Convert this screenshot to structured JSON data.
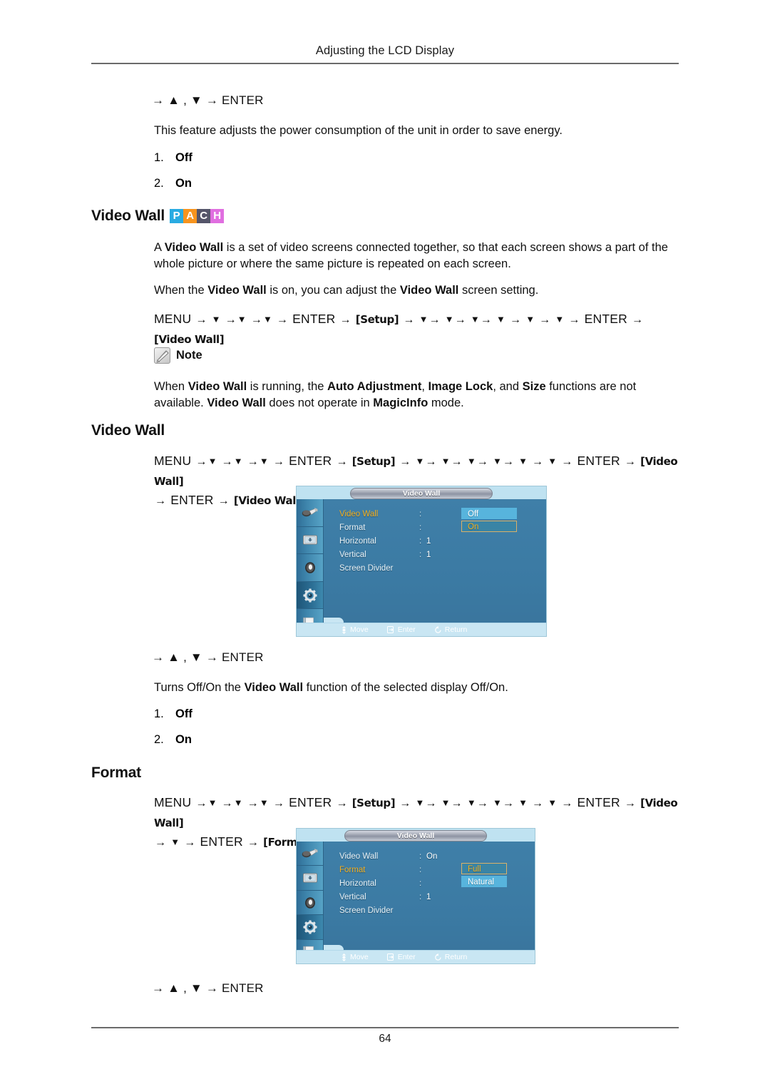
{
  "header": {
    "title": "Adjusting the LCD Display"
  },
  "footer": {
    "page_number": "64"
  },
  "top_section": {
    "key_line": "→ ▲ , ▼ → ENTER",
    "description": "This feature adjusts the power consumption of the unit in order to save energy.",
    "options": [
      {
        "num": "1.",
        "label": "Off"
      },
      {
        "num": "2.",
        "label": "On"
      }
    ]
  },
  "video_wall_section": {
    "heading": "Video Wall",
    "badges": [
      {
        "letter": "P",
        "color": "#29ABE2"
      },
      {
        "letter": "A",
        "color": "#F7941E"
      },
      {
        "letter": "C",
        "color": "#55556A"
      },
      {
        "letter": "H",
        "color": "#E06EE0"
      }
    ],
    "paragraph_1": "A Video Wall is a set of video screens connected together, so that each screen shows a part of the whole picture or where the same picture is repeated on each screen.",
    "paragraph_2": "When the Video Wall is on, you can adjust the Video Wall screen setting.",
    "nav_path": "MENU → ▼ →▼ →▼ → ENTER → [Setup] → ▼→ ▼→ ▼→ ▼ → ▼ → ▼ → ENTER → [Video Wall]",
    "nav_tokens": {
      "menu": "MENU",
      "enter": "ENTER",
      "setup": "Setup",
      "video_wall": "Video Wall"
    },
    "note_label": "Note",
    "note_text": "When Video Wall is running, the Auto Adjustment, Image Lock, and Size functions are not available. Video Wall does not operate in MagicInfo mode."
  },
  "video_wall_sub": {
    "heading": "Video Wall",
    "nav_path": "MENU →▼ →▼ →▼ → ENTER → [Setup] → ▼→ ▼→ ▼→ ▼→ ▼ → ▼ → ENTER → [Video Wall] → ENTER → [Video Wall]",
    "key_line": "→ ▲ , ▼ → ENTER",
    "description": "Turns Off/On the Video Wall function of the selected display Off/On.",
    "options": [
      {
        "num": "1.",
        "label": "Off"
      },
      {
        "num": "2.",
        "label": "On"
      }
    ]
  },
  "format_section": {
    "heading": "Format",
    "nav_path": "MENU →▼ →▼ →▼ → ENTER → [Setup] → ▼→ ▼→ ▼→ ▼→ ▼ → ▼ → ENTER → [Video Wall] → ▼ → ENTER → [Format]",
    "key_line": "→ ▲ , ▼ → ENTER"
  },
  "osd_1": {
    "title": "Video Wall",
    "rows": [
      {
        "label": "Video Wall",
        "colon": ":",
        "value": "",
        "active": true
      },
      {
        "label": "Format",
        "colon": ":",
        "value": "",
        "active": false
      },
      {
        "label": "Horizontal",
        "colon": ":",
        "value": "1",
        "active": false
      },
      {
        "label": "Vertical",
        "colon": ":",
        "value": "1",
        "active": false
      },
      {
        "label": "Screen Divider",
        "colon": "",
        "value": "",
        "active": false
      }
    ],
    "dropdown": [
      {
        "text": "Off",
        "state": "hl"
      },
      {
        "text": "On",
        "state": "cur"
      }
    ],
    "footer": [
      {
        "icon": "move-icon",
        "label": "Move"
      },
      {
        "icon": "enter-icon",
        "label": "Enter"
      },
      {
        "icon": "return-icon",
        "label": "Return"
      }
    ],
    "rail_icons": [
      "picture-icon",
      "screen-icon",
      "sound-icon",
      "setup-gear-icon",
      "multi-control-icon"
    ],
    "rail_selected_index": 3
  },
  "osd_2": {
    "title": "Video Wall",
    "rows": [
      {
        "label": "Video Wall",
        "colon": ":",
        "value": "On",
        "active": false
      },
      {
        "label": "Format",
        "colon": ":",
        "value": "",
        "active": true
      },
      {
        "label": "Horizontal",
        "colon": ":",
        "value": "",
        "active": false
      },
      {
        "label": "Vertical",
        "colon": ":",
        "value": "1",
        "active": false
      },
      {
        "label": "Screen Divider",
        "colon": "",
        "value": "",
        "active": false
      }
    ],
    "dropdown": [
      {
        "text": "Full",
        "state": "cur"
      },
      {
        "text": "Natural",
        "state": "hl"
      }
    ],
    "footer": [
      {
        "icon": "move-icon",
        "label": "Move"
      },
      {
        "icon": "enter-icon",
        "label": "Enter"
      },
      {
        "icon": "return-icon",
        "label": "Return"
      }
    ],
    "rail_icons": [
      "picture-icon",
      "screen-icon",
      "sound-icon",
      "setup-gear-icon",
      "multi-control-icon"
    ],
    "rail_selected_index": 3
  }
}
